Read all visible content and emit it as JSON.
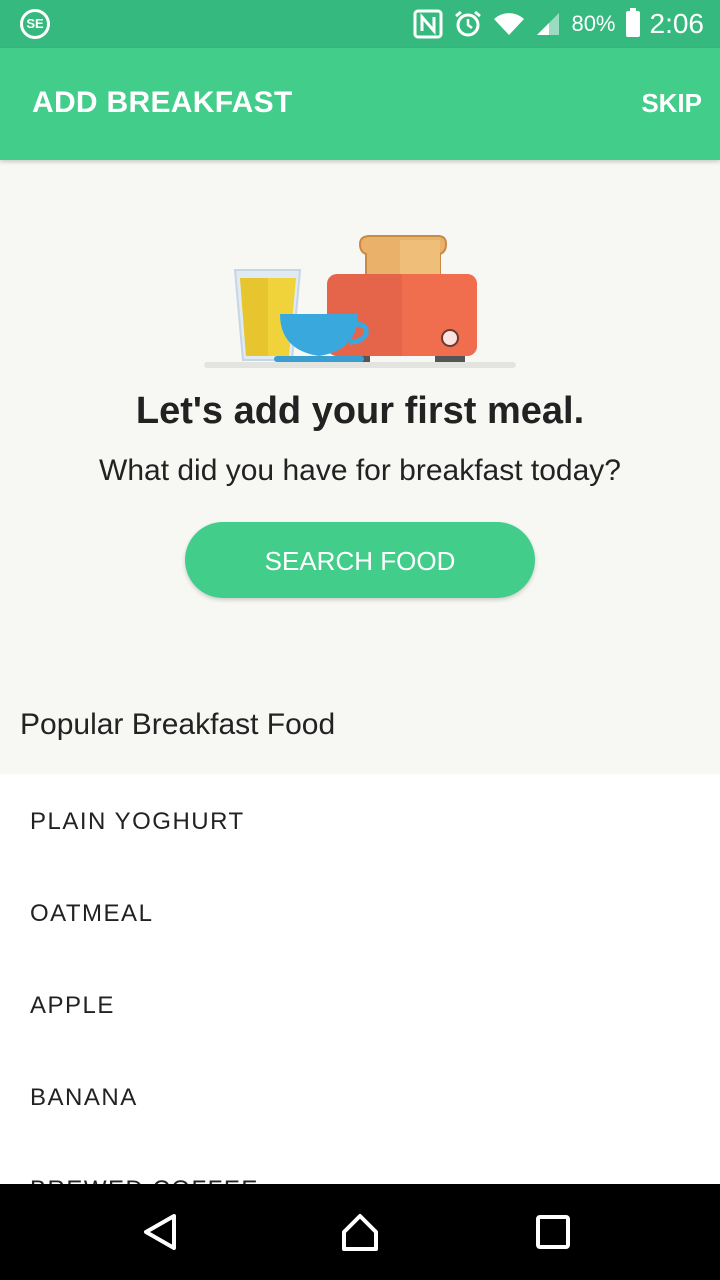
{
  "status_bar": {
    "battery": "80%",
    "time": "2:06",
    "icons": [
      "se-icon",
      "nfc-icon",
      "alarm-icon",
      "wifi-icon",
      "signal-icon",
      "battery-icon"
    ]
  },
  "app_bar": {
    "title": "ADD BREAKFAST",
    "skip_label": "SKIP"
  },
  "empty_state": {
    "headline": "Let's add your first meal.",
    "subline": "What did you have for breakfast today?",
    "search_button": "SEARCH FOOD"
  },
  "popular": {
    "title": "Popular Breakfast Food",
    "items": [
      "PLAIN YOGHURT",
      "OATMEAL",
      "APPLE",
      "BANANA",
      "BREWED COFFEE"
    ]
  },
  "colors": {
    "status_bar": "#35b97e",
    "primary": "#42cd8a",
    "background": "#f7f7f4"
  }
}
